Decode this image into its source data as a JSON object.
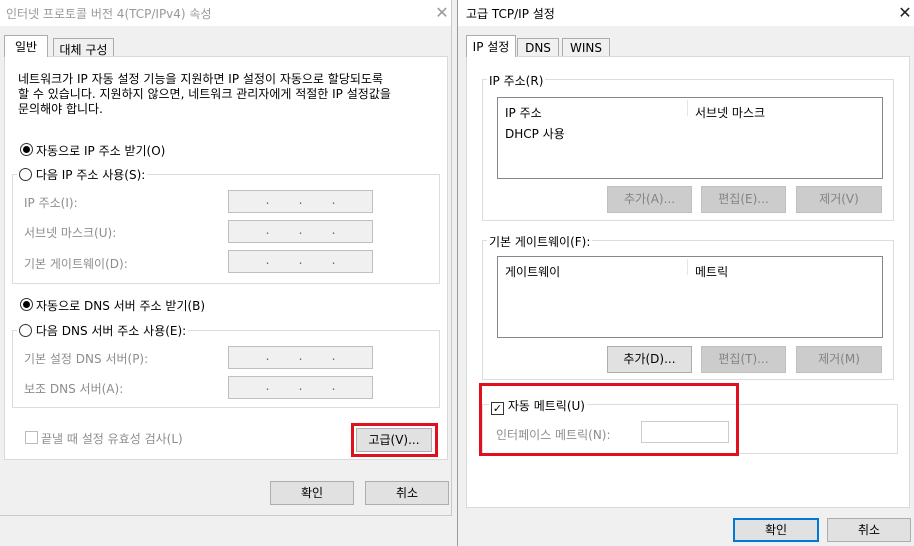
{
  "left_dialog": {
    "title": "인터넷 프로토콜 버전 4(TCP/IPv4) 속성",
    "tabs": [
      "일반",
      "대체 구성"
    ],
    "description": [
      "네트워크가 IP 자동 설정 기능을 지원하면 IP 설정이 자동으로 할당되도록",
      "할 수 있습니다. 지원하지 않으면, 네트워크 관리자에게 적절한 IP 설정값을",
      "문의해야 합니다."
    ],
    "auto_ip_label": "자동으로 IP 주소 받기(O)",
    "manual_ip_label": "다음 IP 주소 사용(S):",
    "ip_address_label": "IP 주소(I):",
    "subnet_label": "서브넷 마스크(U):",
    "gateway_label": "기본 게이트웨이(D):",
    "auto_dns_label": "자동으로 DNS 서버 주소 받기(B)",
    "manual_dns_label": "다음 DNS 서버 주소 사용(E):",
    "preferred_dns_label": "기본 설정 DNS 서버(P):",
    "alternate_dns_label": "보조 DNS 서버(A):",
    "ip_dot": ".",
    "validate_label": "끝낼 때 설정 유효성 검사(L)",
    "advanced_button": "고급(V)...",
    "ok_button": "확인",
    "cancel_button": "취소"
  },
  "right_dialog": {
    "title": "고급 TCP/IP 설정",
    "tabs": [
      "IP 설정",
      "DNS",
      "WINS"
    ],
    "ip_group_label": "IP 주소(R)",
    "ip_list_headers": [
      "IP 주소",
      "서브넷 마스크"
    ],
    "ip_list_rows": [
      [
        "DHCP 사용",
        ""
      ]
    ],
    "ip_add_button": "추가(A)...",
    "ip_edit_button": "편집(E)...",
    "ip_remove_button": "제거(V)",
    "gateway_group_label": "기본 게이트웨이(F):",
    "gateway_list_headers": [
      "게이트웨이",
      "메트릭"
    ],
    "gw_add_button": "추가(D)...",
    "gw_edit_button": "편집(T)...",
    "gw_remove_button": "제거(M)",
    "auto_metric_label": "자동 메트릭(U)",
    "interface_metric_label": "인터페이스 메트릭(N):",
    "ok_button": "확인",
    "cancel_button": "취소"
  },
  "colors": {
    "highlight": "#e0101e",
    "default_button_border": "#0078d7"
  }
}
